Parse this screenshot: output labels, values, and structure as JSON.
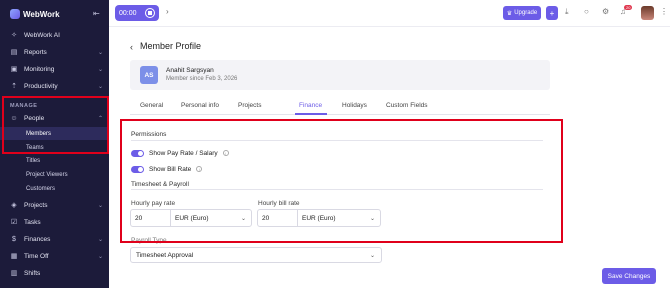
{
  "app": {
    "name": "WebWork"
  },
  "sidebar": {
    "items_top": [
      {
        "label": "WebWork AI",
        "icon": "sparkle-icon"
      },
      {
        "label": "Reports",
        "icon": "reports-icon"
      },
      {
        "label": "Monitoring",
        "icon": "monitoring-icon"
      },
      {
        "label": "Productivity",
        "icon": "productivity-icon"
      }
    ],
    "section_label": "MANAGE",
    "people": {
      "label": "People",
      "icon": "people-icon"
    },
    "people_sub": [
      "Members",
      "Teams",
      "Titles",
      "Project Viewers",
      "Customers"
    ],
    "items_bottom": [
      {
        "label": "Projects",
        "icon": "projects-icon"
      },
      {
        "label": "Tasks",
        "icon": "tasks-icon"
      },
      {
        "label": "Finances",
        "icon": "finances-icon"
      },
      {
        "label": "Time Off",
        "icon": "time-off-icon"
      },
      {
        "label": "Shifts",
        "icon": "shifts-icon"
      }
    ]
  },
  "topbar": {
    "timer": "00:00",
    "upgrade_label": "Upgrade",
    "plus_label": "+",
    "notification_count": "20"
  },
  "page": {
    "title": "Member Profile",
    "member": {
      "initials": "AS",
      "name": "Anahit Sargsyan",
      "since": "Member since Feb 3, 2026"
    },
    "tabs": [
      "General",
      "Personal info",
      "Projects",
      "Finance",
      "Holidays",
      "Custom Fields"
    ],
    "active_tab": "Finance",
    "permissions": {
      "title": "Permissions",
      "show_pay_rate": "Show Pay Rate / Salary",
      "show_bill_rate": "Show Bill Rate"
    },
    "timesheet": {
      "title": "Timesheet & Payroll",
      "hourly_pay_label": "Hourly pay rate",
      "hourly_pay_value": "20",
      "hourly_pay_currency": "EUR (Euro)",
      "hourly_bill_label": "Hourly bill rate",
      "hourly_bill_value": "20",
      "hourly_bill_currency": "EUR (Euro)"
    },
    "payroll": {
      "label": "Payroll Type",
      "value": "Timesheet Approval"
    },
    "save_label": "Save Changes"
  },
  "colors": {
    "accent": "#6c5ce7",
    "sidebar_bg": "#1c1b3a",
    "highlight": "#e0001b"
  }
}
